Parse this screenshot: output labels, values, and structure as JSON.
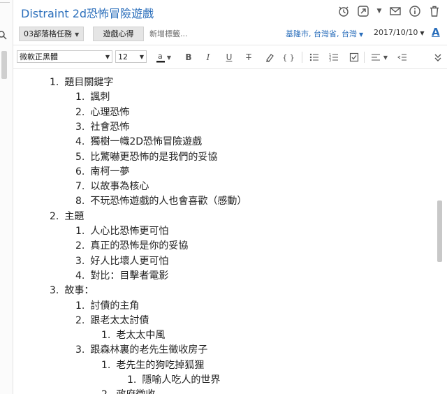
{
  "note": {
    "title": "Distraint 2d恐怖冒險遊戲"
  },
  "meta": {
    "notebook": "03部落格任務",
    "tags": [
      "遊戲心得"
    ],
    "new_tag_placeholder": "新增標籤...",
    "location": "基隆市, 台灣省, 台灣",
    "date": "2017/10/10",
    "font_settings_label": "A"
  },
  "toolbar": {
    "font_family": "微軟正黑體",
    "font_size": "12",
    "icons": [
      "text-color-icon",
      "bold-icon",
      "italic-icon",
      "underline-icon",
      "strikethrough-icon",
      "highlight-icon",
      "code-icon",
      "bullet-list-icon",
      "numbered-list-icon",
      "checkbox-icon",
      "align-icon",
      "outdent-icon",
      "more-icon"
    ]
  },
  "top_icons": [
    "reminder-icon",
    "share-icon",
    "email-icon",
    "info-icon",
    "trash-icon"
  ],
  "content": [
    {
      "number": "1.",
      "text": "題目關鍵字",
      "level": 0
    },
    {
      "number": "1.",
      "text": "諷刺",
      "level": 1
    },
    {
      "number": "2.",
      "text": "心理恐怖",
      "level": 1
    },
    {
      "number": "3.",
      "text": "社會恐怖",
      "level": 1
    },
    {
      "number": "4.",
      "text": "獨樹一幟2D恐怖冒險遊戲",
      "level": 1
    },
    {
      "number": "5.",
      "text": "比驚嚇更恐怖的是我們的妥協",
      "level": 1
    },
    {
      "number": "6.",
      "text": "南柯一夢",
      "level": 1
    },
    {
      "number": "7.",
      "text": "以故事為核心",
      "level": 1
    },
    {
      "number": "8.",
      "text": "不玩恐怖遊戲的人也會喜歡（感動）",
      "level": 1
    },
    {
      "number": "2.",
      "text": "主題",
      "level": 0
    },
    {
      "number": "1.",
      "text": "人心比恐怖更可怕",
      "level": 1
    },
    {
      "number": "2.",
      "text": "真正的恐怖是你的妥協",
      "level": 1
    },
    {
      "number": "3.",
      "text": "好人比壞人更可怕",
      "level": 1
    },
    {
      "number": "4.",
      "text": "對比：目擊者電影",
      "level": 1
    },
    {
      "number": "3.",
      "text": "故事：",
      "level": 0
    },
    {
      "number": "1.",
      "text": "討債的主角",
      "level": 1
    },
    {
      "number": "2.",
      "text": "跟老太太討債",
      "level": 1
    },
    {
      "number": "1.",
      "text": "老太太中風",
      "level": 2
    },
    {
      "number": "3.",
      "text": "跟森林裏的老先生徵收房子",
      "level": 1
    },
    {
      "number": "1.",
      "text": "老先生的狗吃掉狐狸",
      "level": 2
    },
    {
      "number": "1.",
      "text": "隱喻人吃人的世界",
      "level": 3
    },
    {
      "number": "2.",
      "text": "政府徵收",
      "level": 2
    }
  ]
}
